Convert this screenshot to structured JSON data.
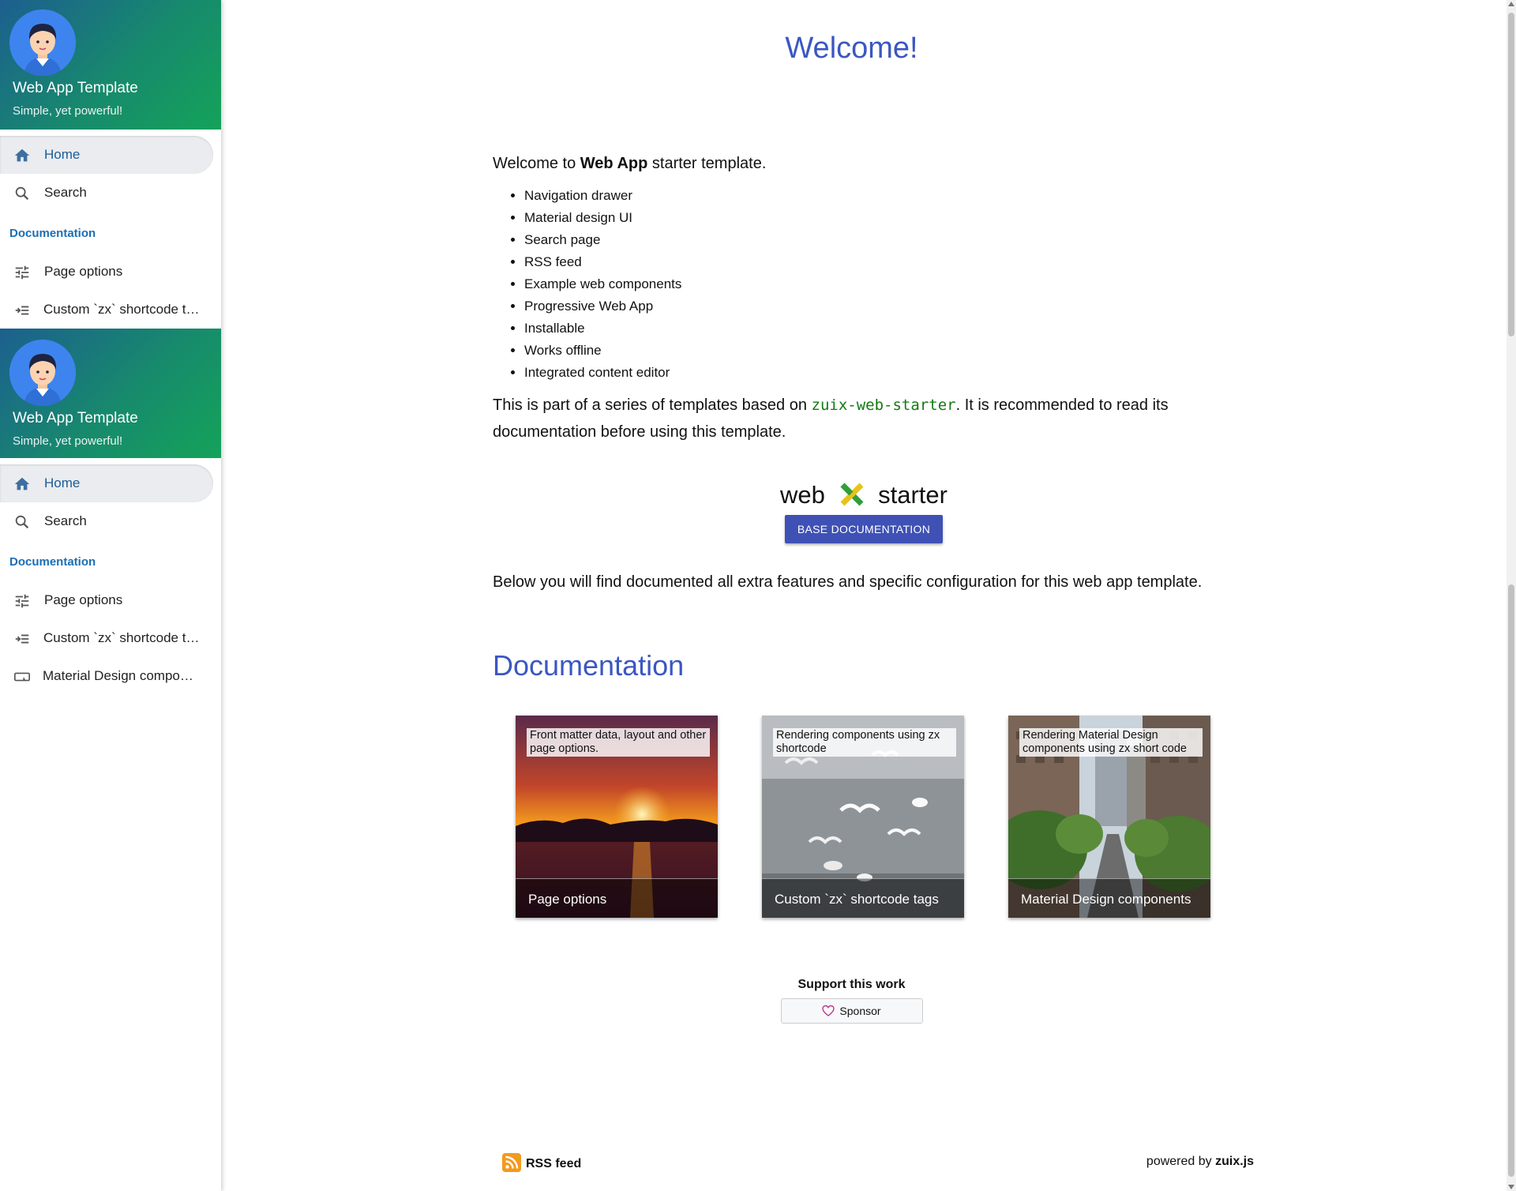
{
  "drawer": {
    "title": "Web App Template",
    "subtitle": "Simple, yet powerful!",
    "header_gradient": [
      "#1c5f8f",
      "#14a35a"
    ]
  },
  "drawer_copy": {
    "title": "Web App Template",
    "subtitle": "Simple, yet powerful!"
  },
  "nav": {
    "home": {
      "label": "Home",
      "icon": "home-icon"
    },
    "search": {
      "label": "Search",
      "icon": "search-icon"
    },
    "section": "Documentation",
    "items": [
      {
        "label": "Page options",
        "icon": "tune-icon"
      },
      {
        "label": "Custom `zx` shortcode t…",
        "icon": "format-indent-icon"
      },
      {
        "label": "Material Design compon…",
        "icon": "button-icon"
      }
    ]
  },
  "main": {
    "welcome": "Welcome!",
    "intro_prefix": "Welcome to ",
    "intro_bold": "Web App",
    "intro_suffix": " starter template.",
    "features": [
      "Navigation drawer",
      "Material design UI",
      "Search page",
      "RSS feed",
      "Example web components",
      "Progressive Web App",
      "Installable",
      "Works offline",
      "Integrated content editor"
    ],
    "series_prefix": "This is part of a series of templates based on ",
    "series_code": "zuix-web-starter",
    "series_suffix": ". It is recommended to read its documentation before using this template.",
    "logo_left": "web",
    "logo_right": "starter",
    "base_doc_button": "BASE DOCUMENTATION",
    "below_text": "Below you will find documented all extra features and specific configuration for this web app template.",
    "doc_heading": "Documentation",
    "cards": [
      {
        "desc": "Front matter data, layout and other page options.",
        "caption": "Page options"
      },
      {
        "desc": "Rendering components using zx shortcode",
        "caption": "Custom `zx` shortcode tags"
      },
      {
        "desc": "Rendering Material Design components using zx short code",
        "caption": "Material Design components"
      }
    ],
    "support_title": "Support this work",
    "sponsor_label": "Sponsor"
  },
  "footer": {
    "rss_label": "RSS feed",
    "powered_prefix": "powered by ",
    "powered_brand": "zuix.js"
  },
  "colors": {
    "accent": "#3b57c2",
    "button": "#3f51b5",
    "section": "#1b6fb5",
    "code": "#127a12"
  }
}
